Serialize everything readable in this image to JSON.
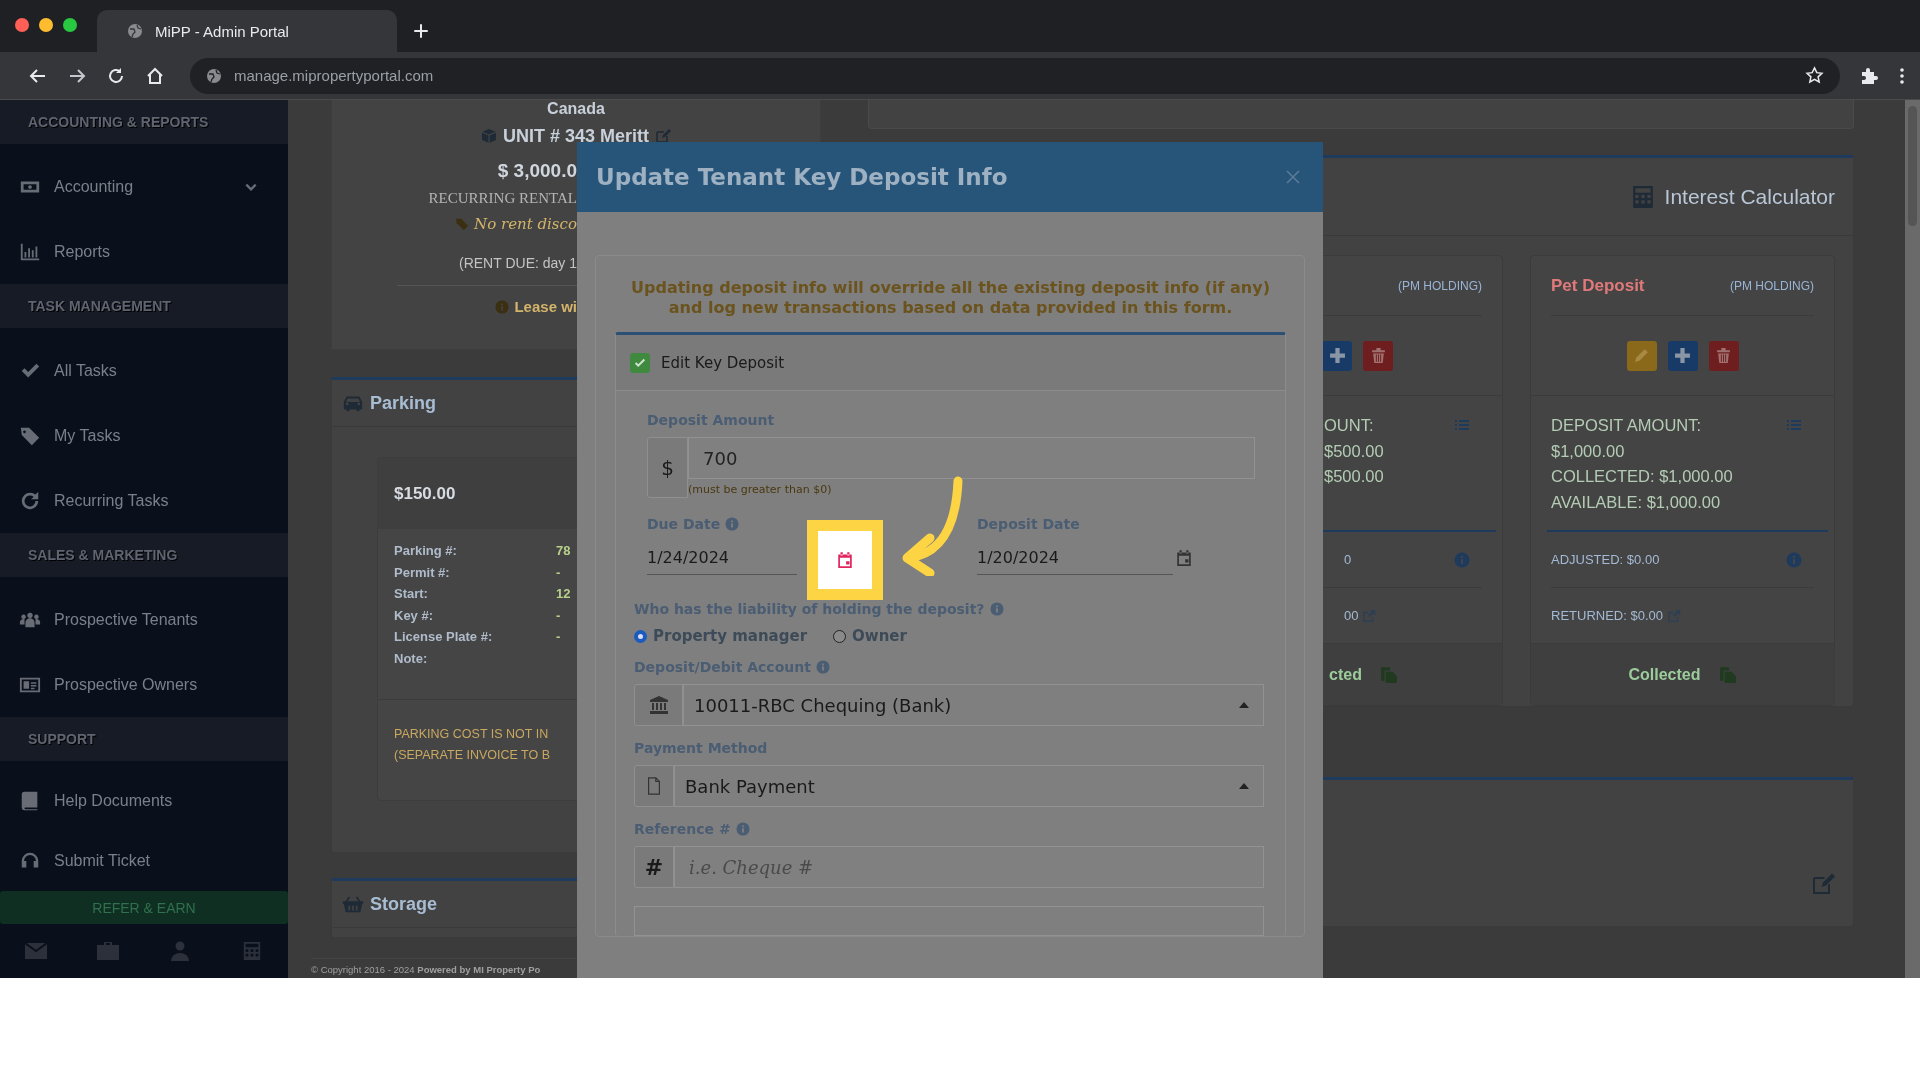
{
  "browser": {
    "tab_title": "MiPP - Admin Portal",
    "url": "manage.mipropertyportal.com"
  },
  "sidebar": {
    "sections": [
      {
        "title": "ACCOUNTING & REPORTS",
        "items": [
          {
            "label": "Accounting",
            "expandable": true
          },
          {
            "label": "Reports",
            "expandable": false
          }
        ]
      },
      {
        "title": "TASK MANAGEMENT",
        "items": [
          {
            "label": "All Tasks",
            "expandable": false
          },
          {
            "label": "My Tasks",
            "expandable": false
          },
          {
            "label": "Recurring Tasks",
            "expandable": false
          }
        ]
      },
      {
        "title": "SALES & MARKETING",
        "items": [
          {
            "label": "Prospective Tenants",
            "expandable": false
          },
          {
            "label": "Prospective Owners",
            "expandable": false
          }
        ]
      },
      {
        "title": "SUPPORT",
        "items": [
          {
            "label": "Help Documents",
            "expandable": false
          },
          {
            "label": "Submit Ticket",
            "expandable": false
          }
        ]
      }
    ],
    "refer_button": "REFER & EARN"
  },
  "unit_card": {
    "location": "Canada",
    "unit": "UNIT # 343 Meritt",
    "rent": "$ 3,000.0",
    "recurring": "RECURRING RENTAL",
    "discount": "No rent disco",
    "rent_due": "(RENT DUE: day 1",
    "lease": "Lease wi"
  },
  "parking": {
    "title": "Parking",
    "amount": "$150.00",
    "rows": [
      {
        "label": "Parking #:",
        "value": "78"
      },
      {
        "label": "Permit #:",
        "value": "-"
      },
      {
        "label": "Start:",
        "value": "12"
      },
      {
        "label": "Key #:",
        "value": "-"
      },
      {
        "label": "License Plate #:",
        "value": "-"
      },
      {
        "label": "Note:"
      }
    ],
    "note_lines": [
      "PARKING COST IS NOT IN",
      "(SEPARATE INVOICE TO B"
    ]
  },
  "storage": {
    "title": "Storage"
  },
  "footer": {
    "copyright": "© Copyright 2016 - 2024 **Powered by MI Property Po**"
  },
  "interest_calculator": {
    "title": "Interest Calculator",
    "deposit_cards": [
      {
        "holding": "(PM HOLDING)",
        "buttons": [
          {
            "kind": "add"
          },
          {
            "kind": "delete"
          }
        ],
        "amount_label": "OUNT:",
        "lines": [
          "$500.00",
          "$500.00"
        ],
        "adjusted": "0",
        "returned": "00",
        "status": "cted"
      },
      {
        "title": "Pet Deposit",
        "holding": "(PM HOLDING)",
        "buttons": [
          {
            "kind": "edit"
          },
          {
            "kind": "add"
          },
          {
            "kind": "delete"
          }
        ],
        "amount_label": "DEPOSIT AMOUNT:",
        "lines": [
          "$1,000.00",
          "COLLECTED: $1,000.00",
          "AVAILABLE: $1,000.00"
        ],
        "adjusted": "ADJUSTED: $0.00",
        "returned": "RETURNED: $0.00",
        "status": "Collected"
      }
    ]
  },
  "modal": {
    "title": "Update Tenant Key Deposit Info",
    "warning": "Updating deposit info will override all the existing deposit info (if any) and log new transactions based on data provided in this form.",
    "edit_checkbox": {
      "label": "Edit Key Deposit",
      "checked": true
    },
    "deposit_amount": {
      "label": "Deposit Amount",
      "prefix": "$",
      "value": "700",
      "hint": "(must be greater than $0)"
    },
    "due_date": {
      "label": "Due Date",
      "value": "1/24/2024"
    },
    "deposit_date": {
      "label": "Deposit Date",
      "value": "1/20/2024"
    },
    "liability": {
      "question": "Who has the liability of holding the deposit?",
      "options": [
        {
          "label": "Property manager",
          "selected": true
        },
        {
          "label": "Owner",
          "selected": false
        }
      ]
    },
    "account": {
      "label": "Deposit/Debit Account",
      "value": "10011-RBC Chequing (Bank)"
    },
    "payment_method": {
      "label": "Payment Method",
      "value": "Bank Payment"
    },
    "reference": {
      "label": "Reference #",
      "prefix": "#",
      "placeholder": "i.e. Cheque #"
    }
  }
}
